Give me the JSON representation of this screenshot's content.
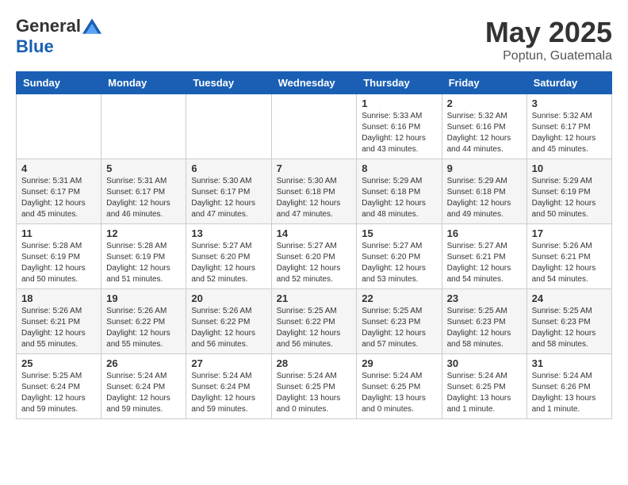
{
  "logo": {
    "general": "General",
    "blue": "Blue"
  },
  "title": {
    "month": "May 2025",
    "location": "Poptun, Guatemala"
  },
  "days_of_week": [
    "Sunday",
    "Monday",
    "Tuesday",
    "Wednesday",
    "Thursday",
    "Friday",
    "Saturday"
  ],
  "weeks": [
    [
      {
        "day": "",
        "info": ""
      },
      {
        "day": "",
        "info": ""
      },
      {
        "day": "",
        "info": ""
      },
      {
        "day": "",
        "info": ""
      },
      {
        "day": "1",
        "info": "Sunrise: 5:33 AM\nSunset: 6:16 PM\nDaylight: 12 hours\nand 43 minutes."
      },
      {
        "day": "2",
        "info": "Sunrise: 5:32 AM\nSunset: 6:16 PM\nDaylight: 12 hours\nand 44 minutes."
      },
      {
        "day": "3",
        "info": "Sunrise: 5:32 AM\nSunset: 6:17 PM\nDaylight: 12 hours\nand 45 minutes."
      }
    ],
    [
      {
        "day": "4",
        "info": "Sunrise: 5:31 AM\nSunset: 6:17 PM\nDaylight: 12 hours\nand 45 minutes."
      },
      {
        "day": "5",
        "info": "Sunrise: 5:31 AM\nSunset: 6:17 PM\nDaylight: 12 hours\nand 46 minutes."
      },
      {
        "day": "6",
        "info": "Sunrise: 5:30 AM\nSunset: 6:17 PM\nDaylight: 12 hours\nand 47 minutes."
      },
      {
        "day": "7",
        "info": "Sunrise: 5:30 AM\nSunset: 6:18 PM\nDaylight: 12 hours\nand 47 minutes."
      },
      {
        "day": "8",
        "info": "Sunrise: 5:29 AM\nSunset: 6:18 PM\nDaylight: 12 hours\nand 48 minutes."
      },
      {
        "day": "9",
        "info": "Sunrise: 5:29 AM\nSunset: 6:18 PM\nDaylight: 12 hours\nand 49 minutes."
      },
      {
        "day": "10",
        "info": "Sunrise: 5:29 AM\nSunset: 6:19 PM\nDaylight: 12 hours\nand 50 minutes."
      }
    ],
    [
      {
        "day": "11",
        "info": "Sunrise: 5:28 AM\nSunset: 6:19 PM\nDaylight: 12 hours\nand 50 minutes."
      },
      {
        "day": "12",
        "info": "Sunrise: 5:28 AM\nSunset: 6:19 PM\nDaylight: 12 hours\nand 51 minutes."
      },
      {
        "day": "13",
        "info": "Sunrise: 5:27 AM\nSunset: 6:20 PM\nDaylight: 12 hours\nand 52 minutes."
      },
      {
        "day": "14",
        "info": "Sunrise: 5:27 AM\nSunset: 6:20 PM\nDaylight: 12 hours\nand 52 minutes."
      },
      {
        "day": "15",
        "info": "Sunrise: 5:27 AM\nSunset: 6:20 PM\nDaylight: 12 hours\nand 53 minutes."
      },
      {
        "day": "16",
        "info": "Sunrise: 5:27 AM\nSunset: 6:21 PM\nDaylight: 12 hours\nand 54 minutes."
      },
      {
        "day": "17",
        "info": "Sunrise: 5:26 AM\nSunset: 6:21 PM\nDaylight: 12 hours\nand 54 minutes."
      }
    ],
    [
      {
        "day": "18",
        "info": "Sunrise: 5:26 AM\nSunset: 6:21 PM\nDaylight: 12 hours\nand 55 minutes."
      },
      {
        "day": "19",
        "info": "Sunrise: 5:26 AM\nSunset: 6:22 PM\nDaylight: 12 hours\nand 55 minutes."
      },
      {
        "day": "20",
        "info": "Sunrise: 5:26 AM\nSunset: 6:22 PM\nDaylight: 12 hours\nand 56 minutes."
      },
      {
        "day": "21",
        "info": "Sunrise: 5:25 AM\nSunset: 6:22 PM\nDaylight: 12 hours\nand 56 minutes."
      },
      {
        "day": "22",
        "info": "Sunrise: 5:25 AM\nSunset: 6:23 PM\nDaylight: 12 hours\nand 57 minutes."
      },
      {
        "day": "23",
        "info": "Sunrise: 5:25 AM\nSunset: 6:23 PM\nDaylight: 12 hours\nand 58 minutes."
      },
      {
        "day": "24",
        "info": "Sunrise: 5:25 AM\nSunset: 6:23 PM\nDaylight: 12 hours\nand 58 minutes."
      }
    ],
    [
      {
        "day": "25",
        "info": "Sunrise: 5:25 AM\nSunset: 6:24 PM\nDaylight: 12 hours\nand 59 minutes."
      },
      {
        "day": "26",
        "info": "Sunrise: 5:24 AM\nSunset: 6:24 PM\nDaylight: 12 hours\nand 59 minutes."
      },
      {
        "day": "27",
        "info": "Sunrise: 5:24 AM\nSunset: 6:24 PM\nDaylight: 12 hours\nand 59 minutes."
      },
      {
        "day": "28",
        "info": "Sunrise: 5:24 AM\nSunset: 6:25 PM\nDaylight: 13 hours\nand 0 minutes."
      },
      {
        "day": "29",
        "info": "Sunrise: 5:24 AM\nSunset: 6:25 PM\nDaylight: 13 hours\nand 0 minutes."
      },
      {
        "day": "30",
        "info": "Sunrise: 5:24 AM\nSunset: 6:25 PM\nDaylight: 13 hours\nand 1 minute."
      },
      {
        "day": "31",
        "info": "Sunrise: 5:24 AM\nSunset: 6:26 PM\nDaylight: 13 hours\nand 1 minute."
      }
    ]
  ]
}
